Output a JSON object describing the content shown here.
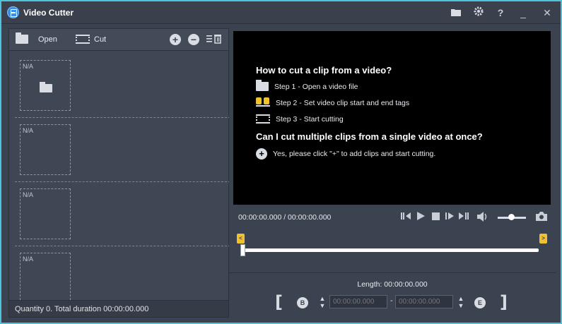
{
  "window": {
    "title": "Video Cutter"
  },
  "titlebar": {
    "icons": [
      "folder-icon",
      "gear-icon",
      "help-icon",
      "minimize-icon",
      "close-icon"
    ],
    "help_glyph": "?",
    "minimize_glyph": "_",
    "close_glyph": "✕"
  },
  "toolbar": {
    "open_label": "Open",
    "cut_label": "Cut",
    "add_glyph": "+",
    "remove_glyph": "−",
    "clear_glyph": "☰🗑"
  },
  "clips": [
    {
      "label": "N/A"
    },
    {
      "label": "N/A"
    },
    {
      "label": "N/A"
    },
    {
      "label": "N/A"
    }
  ],
  "status": {
    "text": "Quantity 0. Total duration 00:00:00.000"
  },
  "help": {
    "heading1": "How to cut a clip from a video?",
    "step1": "Step 1 - Open a video file",
    "step2": "Step 2 - Set video clip start and end tags",
    "step3": "Step 3 - Start cutting",
    "heading2": "Can I cut multiple clips from a single video at once?",
    "answer": "Yes, please click \"+\" to add clips and start cutting."
  },
  "player": {
    "timecode": "00:00:00.000 / 00:00:00.000",
    "controls": [
      "prev-frame-icon",
      "play-icon",
      "stop-icon",
      "next-frame-icon",
      "skip-end-icon",
      "volume-icon",
      "snapshot-icon"
    ],
    "volume_level": 0.5
  },
  "cut": {
    "length": "Length: 00:00:00.000",
    "start_value": "00:00:00.000",
    "end_value": "00:00:00.000",
    "begin_glyph": "B",
    "end_glyph": "E",
    "left_bracket": "[",
    "right_bracket": "]",
    "separator": "-"
  },
  "colors": {
    "accent_border": "#4ec3dc",
    "tag_yellow": "#f2c12e",
    "panel": "#3b4350"
  }
}
